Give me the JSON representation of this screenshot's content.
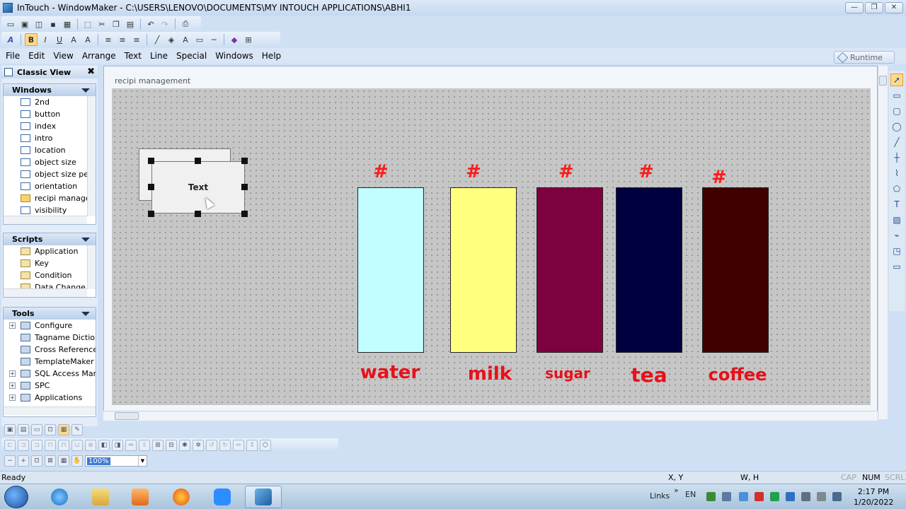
{
  "title": "InTouch - WindowMaker - C:\\USERS\\LENOVO\\DOCUMENTS\\MY INTOUCH APPLICATIONS\\ABHI1",
  "window_controls": {
    "minimize": "—",
    "maximize": "❐",
    "close": "✕"
  },
  "menu": [
    "File",
    "Edit",
    "View",
    "Arrange",
    "Text",
    "Line",
    "Special",
    "Windows",
    "Help"
  ],
  "runtime_label": "Runtime",
  "classic_view": {
    "title": "Classic View",
    "close": "✖",
    "windows": {
      "title": "Windows",
      "items": [
        "2nd",
        "button",
        "index",
        "intro",
        "location",
        "object size",
        "object size pert",
        "orientation",
        "recipi manager",
        "visibility"
      ]
    },
    "scripts": {
      "title": "Scripts",
      "items": [
        "Application",
        "Key",
        "Condition",
        "Data Change"
      ]
    },
    "tools": {
      "title": "Tools",
      "items": [
        "Configure",
        "Tagname Dictiona",
        "Cross Reference",
        "TemplateMaker",
        "SQL Access Mana",
        "SPC",
        "Applications"
      ]
    }
  },
  "editor": {
    "window_title": "recipi management",
    "text_object": "Text",
    "hash_symbol": "#",
    "tanks": [
      {
        "label": "water",
        "color": "#c2feff"
      },
      {
        "label": "milk",
        "color": "#ffff80"
      },
      {
        "label": "sugar",
        "color": "#7d003f"
      },
      {
        "label": "tea",
        "color": "#00003f"
      },
      {
        "label": "coffee",
        "color": "#3f0000"
      }
    ]
  },
  "zoom": "100%",
  "status": {
    "ready": "Ready",
    "xy": "X, Y",
    "wh": "W, H",
    "cap": "CAP",
    "num": "NUM",
    "scrl": "SCRL"
  },
  "taskbar": {
    "links": "Links",
    "lang": "EN",
    "time": "2:17 PM",
    "date": "1/20/2022"
  }
}
